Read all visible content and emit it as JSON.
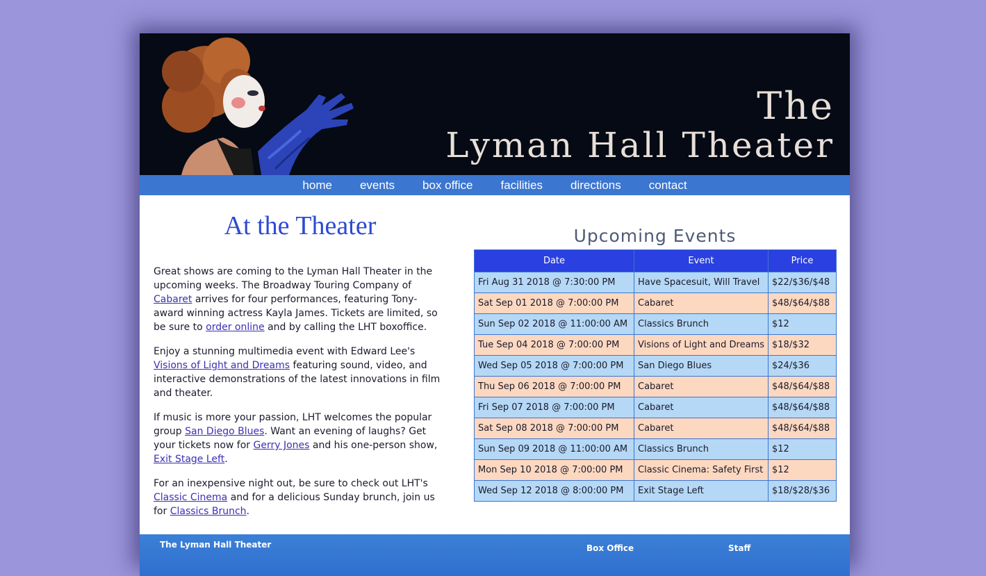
{
  "banner": {
    "title_line1": "The",
    "title_line2": "Lyman Hall Theater"
  },
  "nav": {
    "items": [
      "home",
      "events",
      "box office",
      "facilities",
      "directions",
      "contact"
    ]
  },
  "main": {
    "heading": "At the Theater",
    "p1": {
      "t1": "Great shows are coming to the Lyman Hall Theater in the upcoming weeks. The Broadway Touring Company of ",
      "link1": "Cabaret",
      "t2": " arrives for four performances, featuring Tony-award winning actress Kayla James. Tickets are limited, so be sure to ",
      "link2": "order online",
      "t3": " and by calling the LHT boxoffice."
    },
    "p2": {
      "t1": "Enjoy a stunning multimedia event with Edward Lee's ",
      "link1": "Visions of Light and Dreams",
      "t2": " featuring sound, video, and interactive demonstrations of the latest innovations in film and theater."
    },
    "p3": {
      "t1": "If music is more your passion, LHT welcomes the popular group ",
      "link1": "San Diego Blues",
      "t2": ". Want an evening of laughs? Get your tickets now for ",
      "link2": "Gerry Jones",
      "t3": " and his one-person show, ",
      "link3": "Exit Stage Left",
      "t4": "."
    },
    "p4": {
      "t1": "For an inexpensive night out, be sure to check out LHT's ",
      "link1": "Classic Cinema",
      "t2": " and for a delicious Sunday brunch, join us for ",
      "link2": "Classics Brunch",
      "t3": "."
    }
  },
  "events": {
    "heading": "Upcoming Events",
    "columns": [
      "Date",
      "Event",
      "Price"
    ],
    "rows": [
      [
        "Fri Aug 31 2018 @ 7:30:00 PM",
        "Have Spacesuit, Will Travel",
        "$22/$36/$48"
      ],
      [
        "Sat Sep 01 2018 @ 7:00:00 PM",
        "Cabaret",
        "$48/$64/$88"
      ],
      [
        "Sun Sep 02 2018 @ 11:00:00 AM",
        "Classics Brunch",
        "$12"
      ],
      [
        "Tue Sep 04 2018 @ 7:00:00 PM",
        "Visions of Light and Dreams",
        "$18/$32"
      ],
      [
        "Wed Sep 05 2018 @ 7:00:00 PM",
        "San Diego Blues",
        "$24/$36"
      ],
      [
        "Thu Sep 06 2018 @ 7:00:00 PM",
        "Cabaret",
        "$48/$64/$88"
      ],
      [
        "Fri Sep 07 2018 @ 7:00:00 PM",
        "Cabaret",
        "$48/$64/$88"
      ],
      [
        "Sat Sep 08 2018 @ 7:00:00 PM",
        "Cabaret",
        "$48/$64/$88"
      ],
      [
        "Sun Sep 09 2018 @ 11:00:00 AM",
        "Classics Brunch",
        "$12"
      ],
      [
        "Mon Sep 10 2018 @ 7:00:00 PM",
        "Classic Cinema: Safety First",
        "$12"
      ],
      [
        "Wed Sep 12 2018 @ 8:00:00 PM",
        "Exit Stage Left",
        "$18/$28/$36"
      ]
    ]
  },
  "footer": {
    "site_name": "The Lyman Hall Theater",
    "col1": "Box Office",
    "col2": "Staff"
  },
  "colors": {
    "background": "#9b95dc",
    "nav": "#3b76d0",
    "table_header": "#2a40e0",
    "row_blue": "#b5d8f6",
    "row_peach": "#fdd8c0",
    "heading": "#2c4ad3"
  }
}
